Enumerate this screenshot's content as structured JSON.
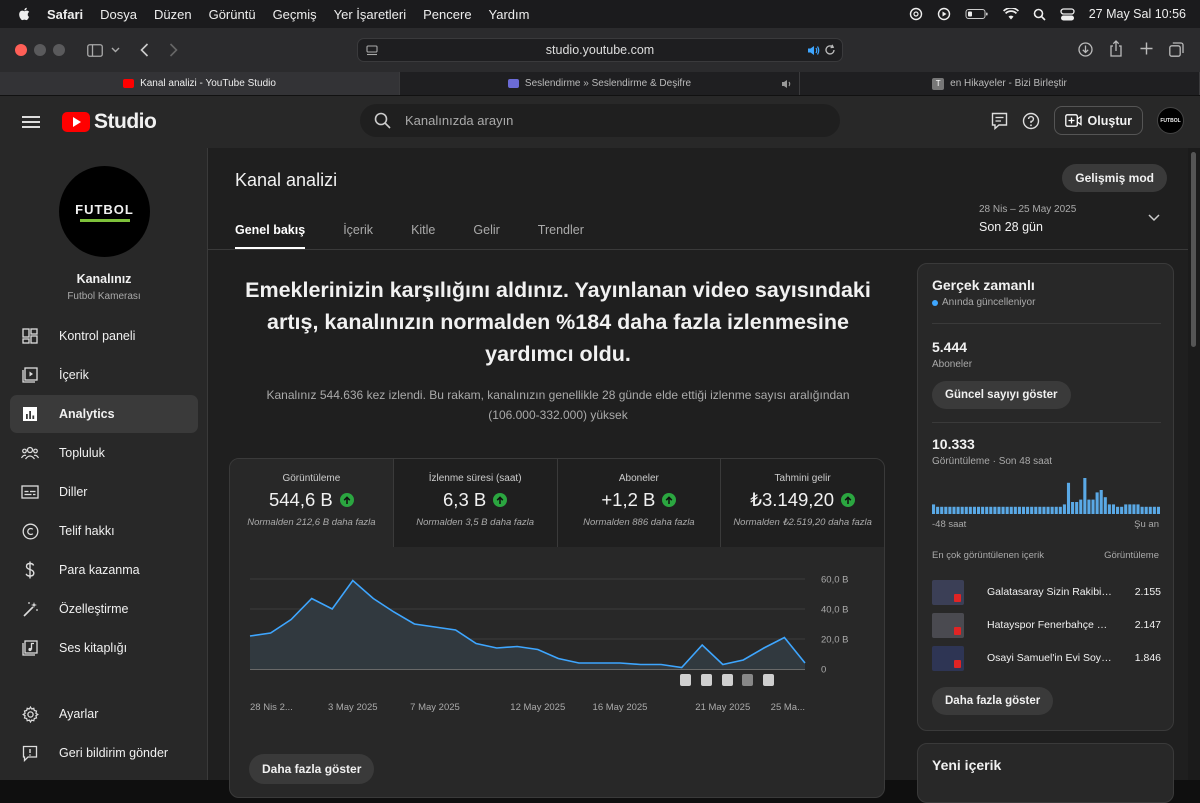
{
  "menubar": {
    "app": "Safari",
    "items": [
      "Dosya",
      "Düzen",
      "Görüntü",
      "Geçmiş",
      "Yer İşaretleri",
      "Pencere",
      "Yardım"
    ],
    "datetime": "27 May Sal  10:56"
  },
  "browser": {
    "url": "studio.youtube.com",
    "tabs": [
      {
        "label": "Kanal analizi - YouTube Studio"
      },
      {
        "label": "Seslendirme » Seslendirme & Deşifre"
      },
      {
        "label": "en Hikayeler - Bizi Birleştir"
      }
    ]
  },
  "header": {
    "logo_text": "Studio",
    "search_placeholder": "Kanalınızda arayın",
    "create_label": "Oluştur",
    "avatar_text": "FUTBOL"
  },
  "sidebar": {
    "channel_logo": "FUTBOL",
    "channel_title": "Kanalınız",
    "channel_name": "Futbol Kamerası",
    "items": [
      {
        "label": "Kontrol paneli",
        "icon": "dashboard-icon"
      },
      {
        "label": "İçerik",
        "icon": "content-icon"
      },
      {
        "label": "Analytics",
        "icon": "analytics-icon",
        "active": true
      },
      {
        "label": "Topluluk",
        "icon": "community-icon"
      },
      {
        "label": "Diller",
        "icon": "subtitles-icon"
      },
      {
        "label": "Telif hakkı",
        "icon": "copyright-icon"
      },
      {
        "label": "Para kazanma",
        "icon": "dollar-icon"
      },
      {
        "label": "Özelleştirme",
        "icon": "magic-wand-icon"
      },
      {
        "label": "Ses kitaplığı",
        "icon": "audio-library-icon"
      }
    ],
    "bottom": [
      {
        "label": "Ayarlar",
        "icon": "gear-icon"
      },
      {
        "label": "Geri bildirim gönder",
        "icon": "feedback-icon"
      }
    ]
  },
  "page": {
    "title": "Kanal analizi",
    "advanced_mode": "Gelişmiş mod",
    "tabs": [
      "Genel bakış",
      "İçerik",
      "Kitle",
      "Gelir",
      "Trendler"
    ],
    "date_range": "28 Nis – 25 May 2025",
    "period": "Son 28 gün",
    "headline": "Emeklerinizin karşılığını aldınız. Yayınlanan video sayısındaki artış, kanalınızın normalden %184 daha fazla izlenmesine yardımcı oldu.",
    "subtext": "Kanalınız 544.636 kez izlendi. Bu rakam, kanalınızın genellikle 28 günde elde ettiği izlenme sayısı aralığından (106.000-332.000) yüksek",
    "show_more": "Daha fazla göster"
  },
  "metrics": [
    {
      "title": "Görüntüleme",
      "value": "544,6 B",
      "note": "Normalden 212,6 B daha fazla"
    },
    {
      "title": "İzlenme süresi (saat)",
      "value": "6,3 B",
      "note": "Normalden 3,5 B daha fazla"
    },
    {
      "title": "Aboneler",
      "value": "+1,2 B",
      "note": "Normalden 886 daha fazla"
    },
    {
      "title": "Tahmini gelir",
      "value": "₺3.149,20",
      "note": "Normalden ₺2.519,20 daha fazla"
    }
  ],
  "chart_data": {
    "type": "area",
    "x": [
      "28 Nis",
      "29 Nis",
      "30 Nis",
      "1 May",
      "2 May",
      "3 May",
      "4 May",
      "5 May",
      "6 May",
      "7 May",
      "8 May",
      "9 May",
      "10 May",
      "11 May",
      "12 May",
      "13 May",
      "14 May",
      "15 May",
      "16 May",
      "17 May",
      "18 May",
      "19 May",
      "20 May",
      "21 May",
      "22 May",
      "23 May",
      "24 May",
      "25 May"
    ],
    "values": [
      22,
      24,
      33,
      47,
      40,
      59,
      47,
      38,
      30,
      28,
      26,
      17,
      14,
      15,
      13,
      7,
      4,
      4,
      4,
      3,
      3,
      1,
      16,
      3,
      6,
      14,
      21,
      4
    ],
    "tick_labels": [
      "28 Nis 2...",
      "3 May 2025",
      "7 May 2025",
      "12 May 2025",
      "16 May 2025",
      "21 May 2025",
      "25 Ma..."
    ],
    "tick_index": [
      0,
      5,
      9,
      14,
      18,
      23,
      27
    ],
    "y_ticks": [
      "60,0 B",
      "40,0 B",
      "20,0 B",
      "0"
    ],
    "ylim": [
      0,
      60
    ],
    "color": "#3ea6ff"
  },
  "realtime": {
    "title": "Gerçek zamanlı",
    "live": "Anında güncelleniyor",
    "subs_value": "5.444",
    "subs_label": "Aboneler",
    "subs_button": "Güncel sayıyı göster",
    "views_value": "10.333",
    "views_label": "Görüntüleme · Son 48 saat",
    "bar_values": [
      4,
      3,
      3,
      3,
      3,
      3,
      3,
      3,
      3,
      3,
      3,
      3,
      3,
      3,
      3,
      3,
      3,
      3,
      3,
      3,
      3,
      3,
      3,
      3,
      3,
      3,
      3,
      3,
      3,
      3,
      3,
      3,
      4,
      13,
      5,
      5,
      6,
      15,
      6,
      6,
      9,
      10,
      7,
      4,
      4,
      3,
      3,
      4,
      4,
      4,
      4,
      3,
      3,
      3,
      3,
      3
    ],
    "axis_left": "-48 saat",
    "axis_right": "Şu an",
    "top_title": "En çok görüntülenen içerik",
    "top_col": "Görüntüleme",
    "top": [
      {
        "title": "Galatasaray Sizin Rakibiniz Değil!",
        "views": "2.155"
      },
      {
        "title": "Hatayspor Fenerbahçe Maçı",
        "views": "2.147"
      },
      {
        "title": "Osayi Samuel'in Evi Soyuldu",
        "views": "1.846"
      }
    ],
    "more_button": "Daha fazla göster"
  },
  "new_content": {
    "title": "Yeni içerik"
  }
}
